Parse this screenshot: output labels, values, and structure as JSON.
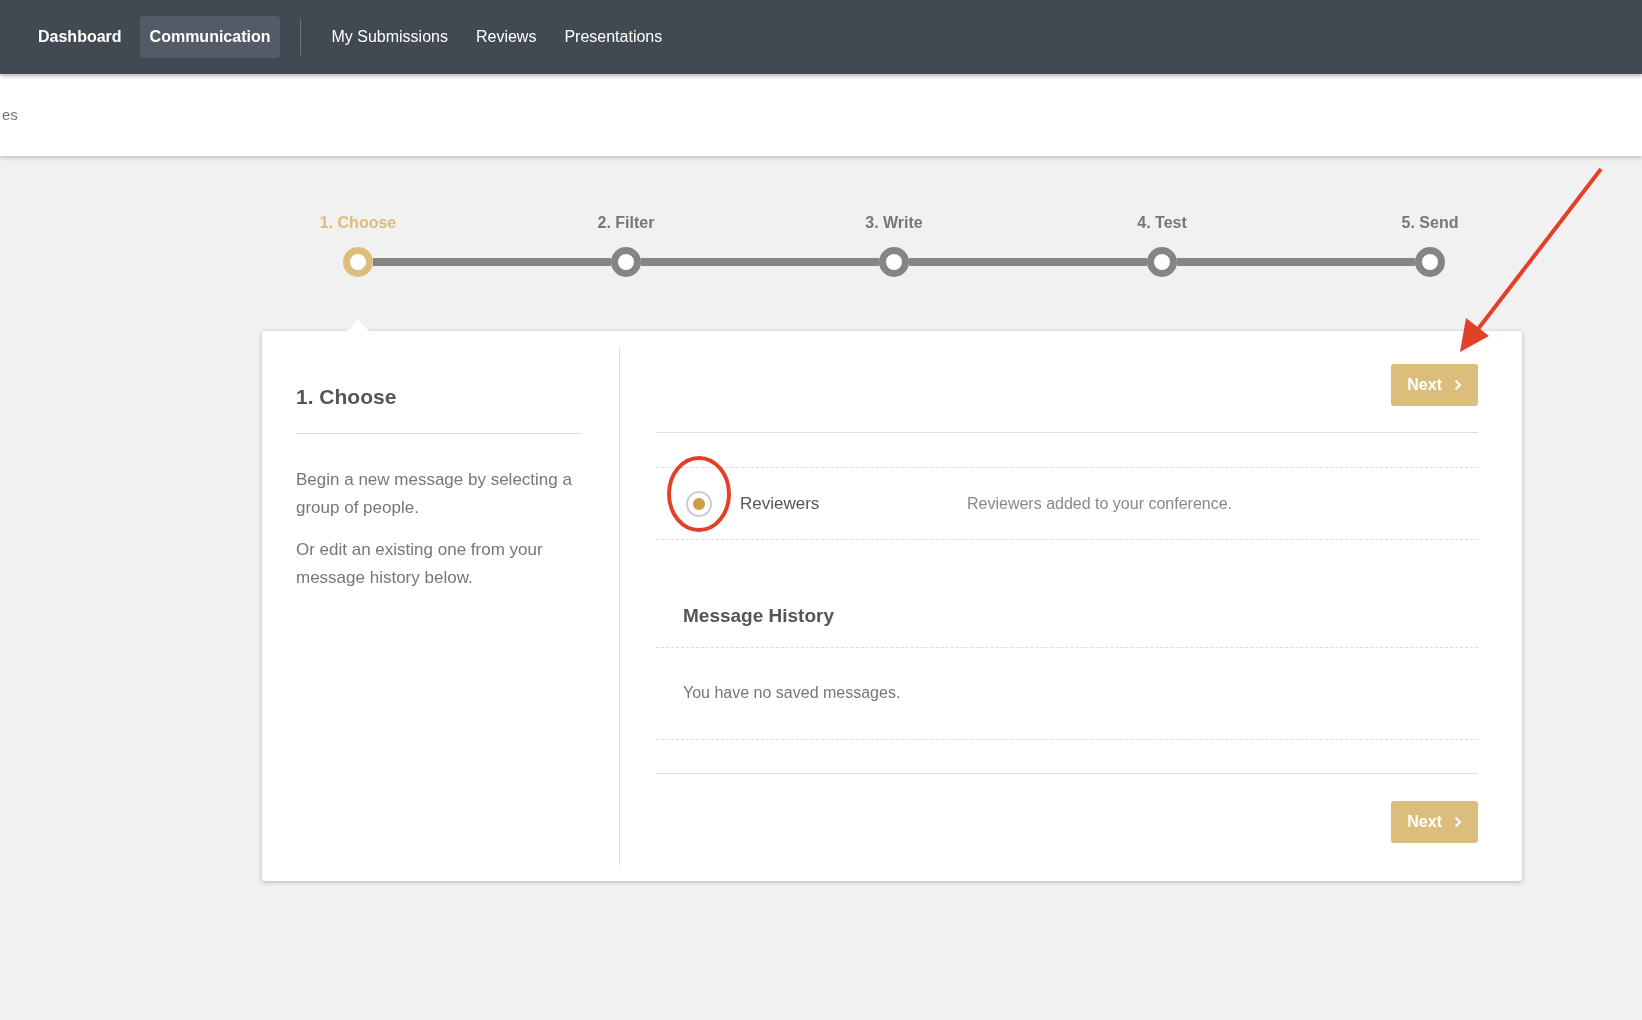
{
  "nav": {
    "items": [
      {
        "label": "Dashboard",
        "selected": false
      },
      {
        "label": "Communication",
        "selected": true
      },
      {
        "label": "My Submissions",
        "selected": false
      },
      {
        "label": "Reviews",
        "selected": false
      },
      {
        "label": "Presentations",
        "selected": false
      }
    ]
  },
  "subbar": {
    "text": "es"
  },
  "steps": [
    {
      "label": "1. Choose",
      "selected": true
    },
    {
      "label": "2. Filter",
      "selected": false
    },
    {
      "label": "3. Write",
      "selected": false
    },
    {
      "label": "4. Test",
      "selected": false
    },
    {
      "label": "5. Send",
      "selected": false
    }
  ],
  "panel": {
    "title": "1. Choose",
    "paragraphs": [
      "Begin a new message by selecting a group of people.",
      "Or edit an existing one from your message history below."
    ]
  },
  "next_buttons": [
    "Next",
    "Next"
  ],
  "groups": [
    {
      "label": "Reviewers",
      "description": "Reviewers added to your conference.",
      "selected": true
    }
  ],
  "history": {
    "title": "Message History",
    "empty_text": "You have no saved messages."
  }
}
